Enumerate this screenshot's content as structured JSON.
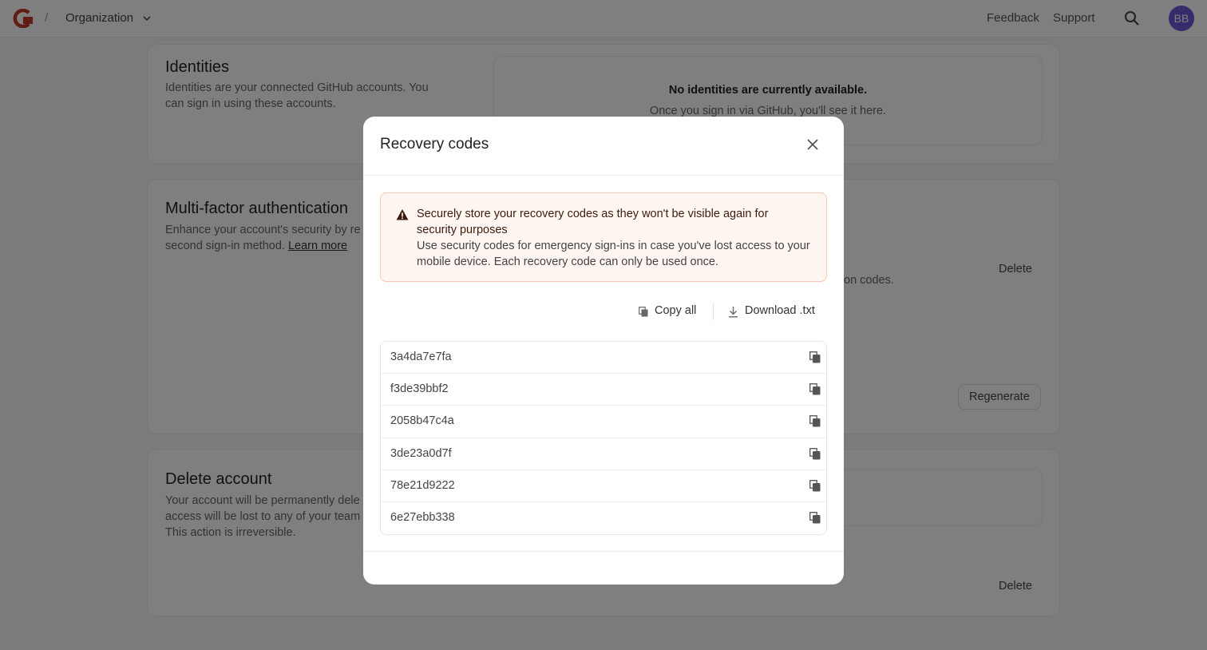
{
  "header": {
    "separator": "/",
    "org_label": "Organization",
    "feedback": "Feedback",
    "support": "Support",
    "avatar_initials": "BB",
    "avatar_color": "#6b5bd6",
    "brand_color": "#c0392b"
  },
  "identities": {
    "title": "Identities",
    "description": "Identities are your connected GitHub accounts. You can sign in using these accounts.",
    "empty_title": "No identities are currently available.",
    "empty_sub": "Once you sign in via GitHub, you'll see it here."
  },
  "mfa": {
    "title": "Multi-factor authentication",
    "description": "Enhance your account's security by re",
    "description_2": "second sign-in method.",
    "learn_more": "Learn more",
    "delete_label": "Delete",
    "codes_fragment": "on codes.",
    "regenerate_label": "Regenerate"
  },
  "delete_account": {
    "title": "Delete account",
    "line1": "Your account will be permanently dele",
    "line2": "access will be lost to any of your team",
    "line3": "This action is irreversible.",
    "delete_label": "Delete"
  },
  "modal": {
    "title": "Recovery codes",
    "alert_title": "Securely store your recovery codes as they won't be visible again for security purposes",
    "alert_body": "Use security codes for emergency sign-ins in case you've lost access to your mobile device. Each recovery code can only be used once.",
    "copy_all": "Copy all",
    "download": "Download .txt",
    "codes": [
      "3a4da7e7fa",
      "f3de39bbf2",
      "2058b47c4a",
      "3de23a0d7f",
      "78e21d9222",
      "6e27ebb338"
    ]
  }
}
